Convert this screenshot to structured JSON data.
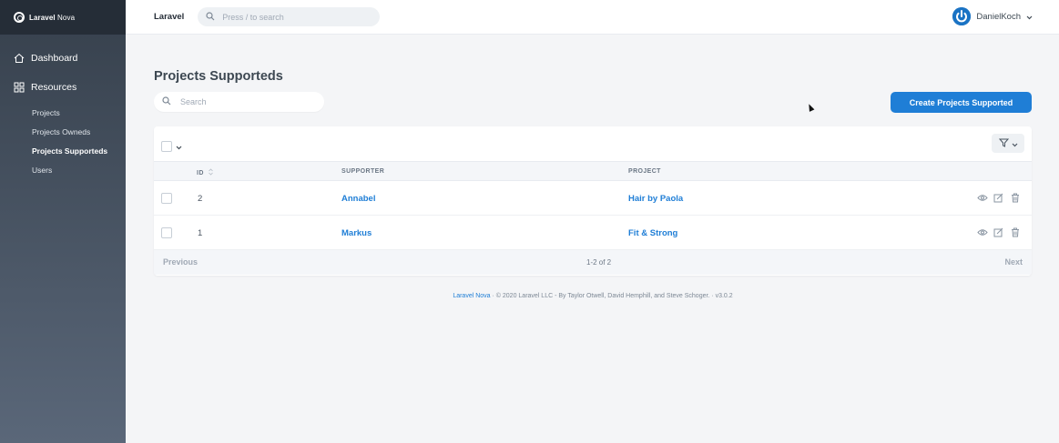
{
  "brand": {
    "name_bold": "Laravel",
    "name_light": " Nova"
  },
  "sidebar": {
    "dashboard_label": "Dashboard",
    "resources_label": "Resources",
    "items": [
      {
        "label": "Projects",
        "active": false
      },
      {
        "label": "Projects Owneds",
        "active": false
      },
      {
        "label": "Projects Supporteds",
        "active": true
      },
      {
        "label": "Users",
        "active": false
      }
    ]
  },
  "header": {
    "title": "Laravel",
    "search_placeholder": "Press / to search",
    "user_name": "DanielKoch"
  },
  "main": {
    "page_title": "Projects Supporteds",
    "search_placeholder": "Search",
    "create_button": "Create Projects Supported",
    "table": {
      "columns": [
        "ID",
        "SUPPORTER",
        "PROJECT"
      ],
      "rows": [
        {
          "id": "2",
          "supporter": "Annabel",
          "project": "Hair by Paola"
        },
        {
          "id": "1",
          "supporter": "Markus",
          "project": "Fit & Strong"
        }
      ]
    },
    "pagination": {
      "previous": "Previous",
      "count": "1-2 of 2",
      "next": "Next"
    }
  },
  "footer": {
    "link": "Laravel Nova",
    "text": " · © 2020 Laravel LLC - By Taylor Otwell, David Hemphill, and Steve Schoger. · v3.0.2"
  },
  "colors": {
    "accent": "#1f7ed6",
    "sidebar_top": "#36404c",
    "sidebar_bottom": "#5a6779"
  }
}
